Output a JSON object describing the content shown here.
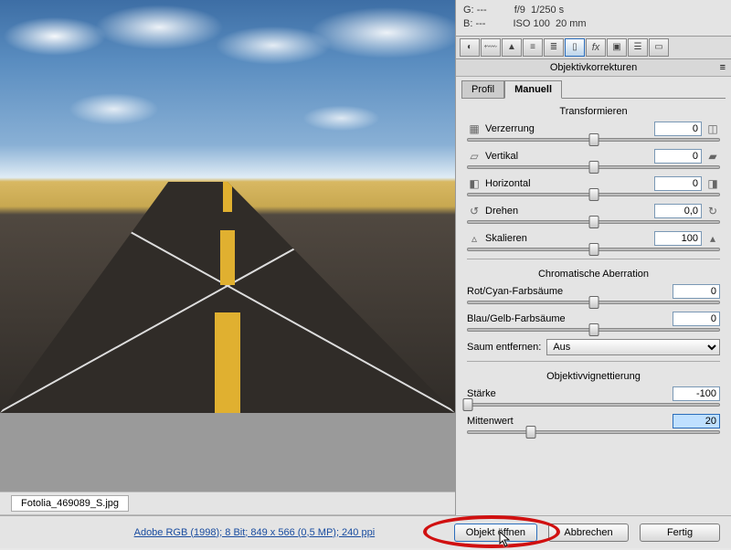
{
  "info": {
    "g_label": "G:",
    "g_value": "---",
    "b_label": "B:",
    "b_value": "---",
    "aperture": "f/9",
    "shutter": "1/250 s",
    "iso": "ISO 100",
    "focal": "20 mm"
  },
  "panel_title": "Objektivkorrekturen",
  "tabs": {
    "profile": "Profil",
    "manual": "Manuell"
  },
  "sections": {
    "transform": "Transformieren",
    "chromatic": "Chromatische Aberration",
    "vignette": "Objektivvignettierung"
  },
  "controls": {
    "distortion": {
      "label": "Verzerrung",
      "value": "0",
      "thumb_pct": 50
    },
    "vertical": {
      "label": "Vertikal",
      "value": "0",
      "thumb_pct": 50
    },
    "horizontal": {
      "label": "Horizontal",
      "value": "0",
      "thumb_pct": 50
    },
    "rotate": {
      "label": "Drehen",
      "value": "0,0",
      "thumb_pct": 50
    },
    "scale": {
      "label": "Skalieren",
      "value": "100",
      "thumb_pct": 50
    },
    "redcyan": {
      "label": "Rot/Cyan-Farbsäume",
      "value": "0",
      "thumb_pct": 50
    },
    "blueyellow": {
      "label": "Blau/Gelb-Farbsäume",
      "value": "0",
      "thumb_pct": 50
    },
    "defringe_label": "Saum entfernen:",
    "defringe_value": "Aus",
    "strength": {
      "label": "Stärke",
      "value": "-100",
      "thumb_pct": 0
    },
    "midpoint": {
      "label": "Mittenwert",
      "value": "20",
      "thumb_pct": 25
    }
  },
  "filename": "Fotolia_469089_S.jpg",
  "profile": "Adobe RGB (1998); 8 Bit; 849 x 566 (0,5 MP); 240 ppi",
  "buttons": {
    "open": "Objekt öffnen",
    "cancel": "Abbrechen",
    "done": "Fertig"
  },
  "chart_data": null
}
